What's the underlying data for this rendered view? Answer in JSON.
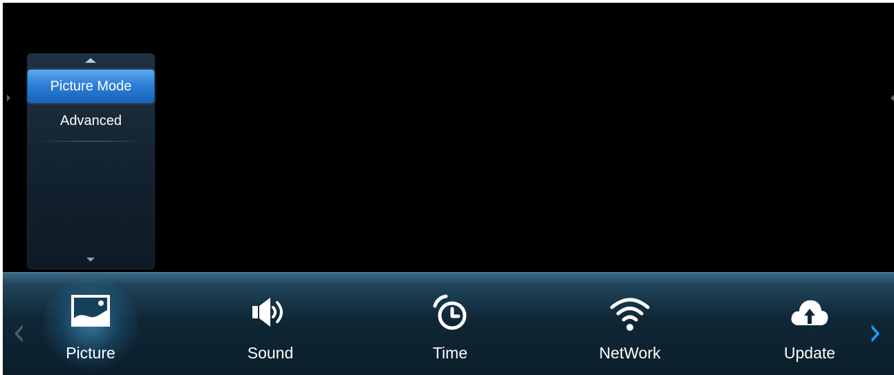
{
  "submenu": {
    "items": [
      {
        "label": "Picture Mode",
        "selected": true
      },
      {
        "label": "Advanced",
        "selected": false
      }
    ]
  },
  "navbar": {
    "items": [
      {
        "label": "Picture",
        "icon": "picture-icon",
        "selected": true
      },
      {
        "label": "Sound",
        "icon": "speaker-icon",
        "selected": false
      },
      {
        "label": "Time",
        "icon": "clock-icon",
        "selected": false
      },
      {
        "label": "NetWork",
        "icon": "wifi-icon",
        "selected": false
      },
      {
        "label": "Update",
        "icon": "cloud-upload-icon",
        "selected": false
      }
    ],
    "prev_arrow": "‹",
    "next_arrow": "›"
  },
  "colors": {
    "accent": "#2c7fd8",
    "next_arrow": "#1e9cf4",
    "background": "#000000"
  }
}
